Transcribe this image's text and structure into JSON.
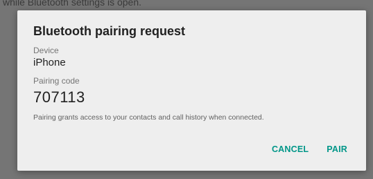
{
  "background": {
    "text": "while Bluetooth settings is open."
  },
  "dialog": {
    "title": "Bluetooth pairing request",
    "device_label": "Device",
    "device_value": "iPhone",
    "code_label": "Pairing code",
    "code_value": "707113",
    "note": "Pairing grants access to your contacts and call history when connected.",
    "buttons": {
      "cancel": "CANCEL",
      "pair": "PAIR"
    }
  },
  "colors": {
    "accent": "#009688",
    "scrim": "#757575",
    "dialog_bg": "#eeeeee"
  }
}
